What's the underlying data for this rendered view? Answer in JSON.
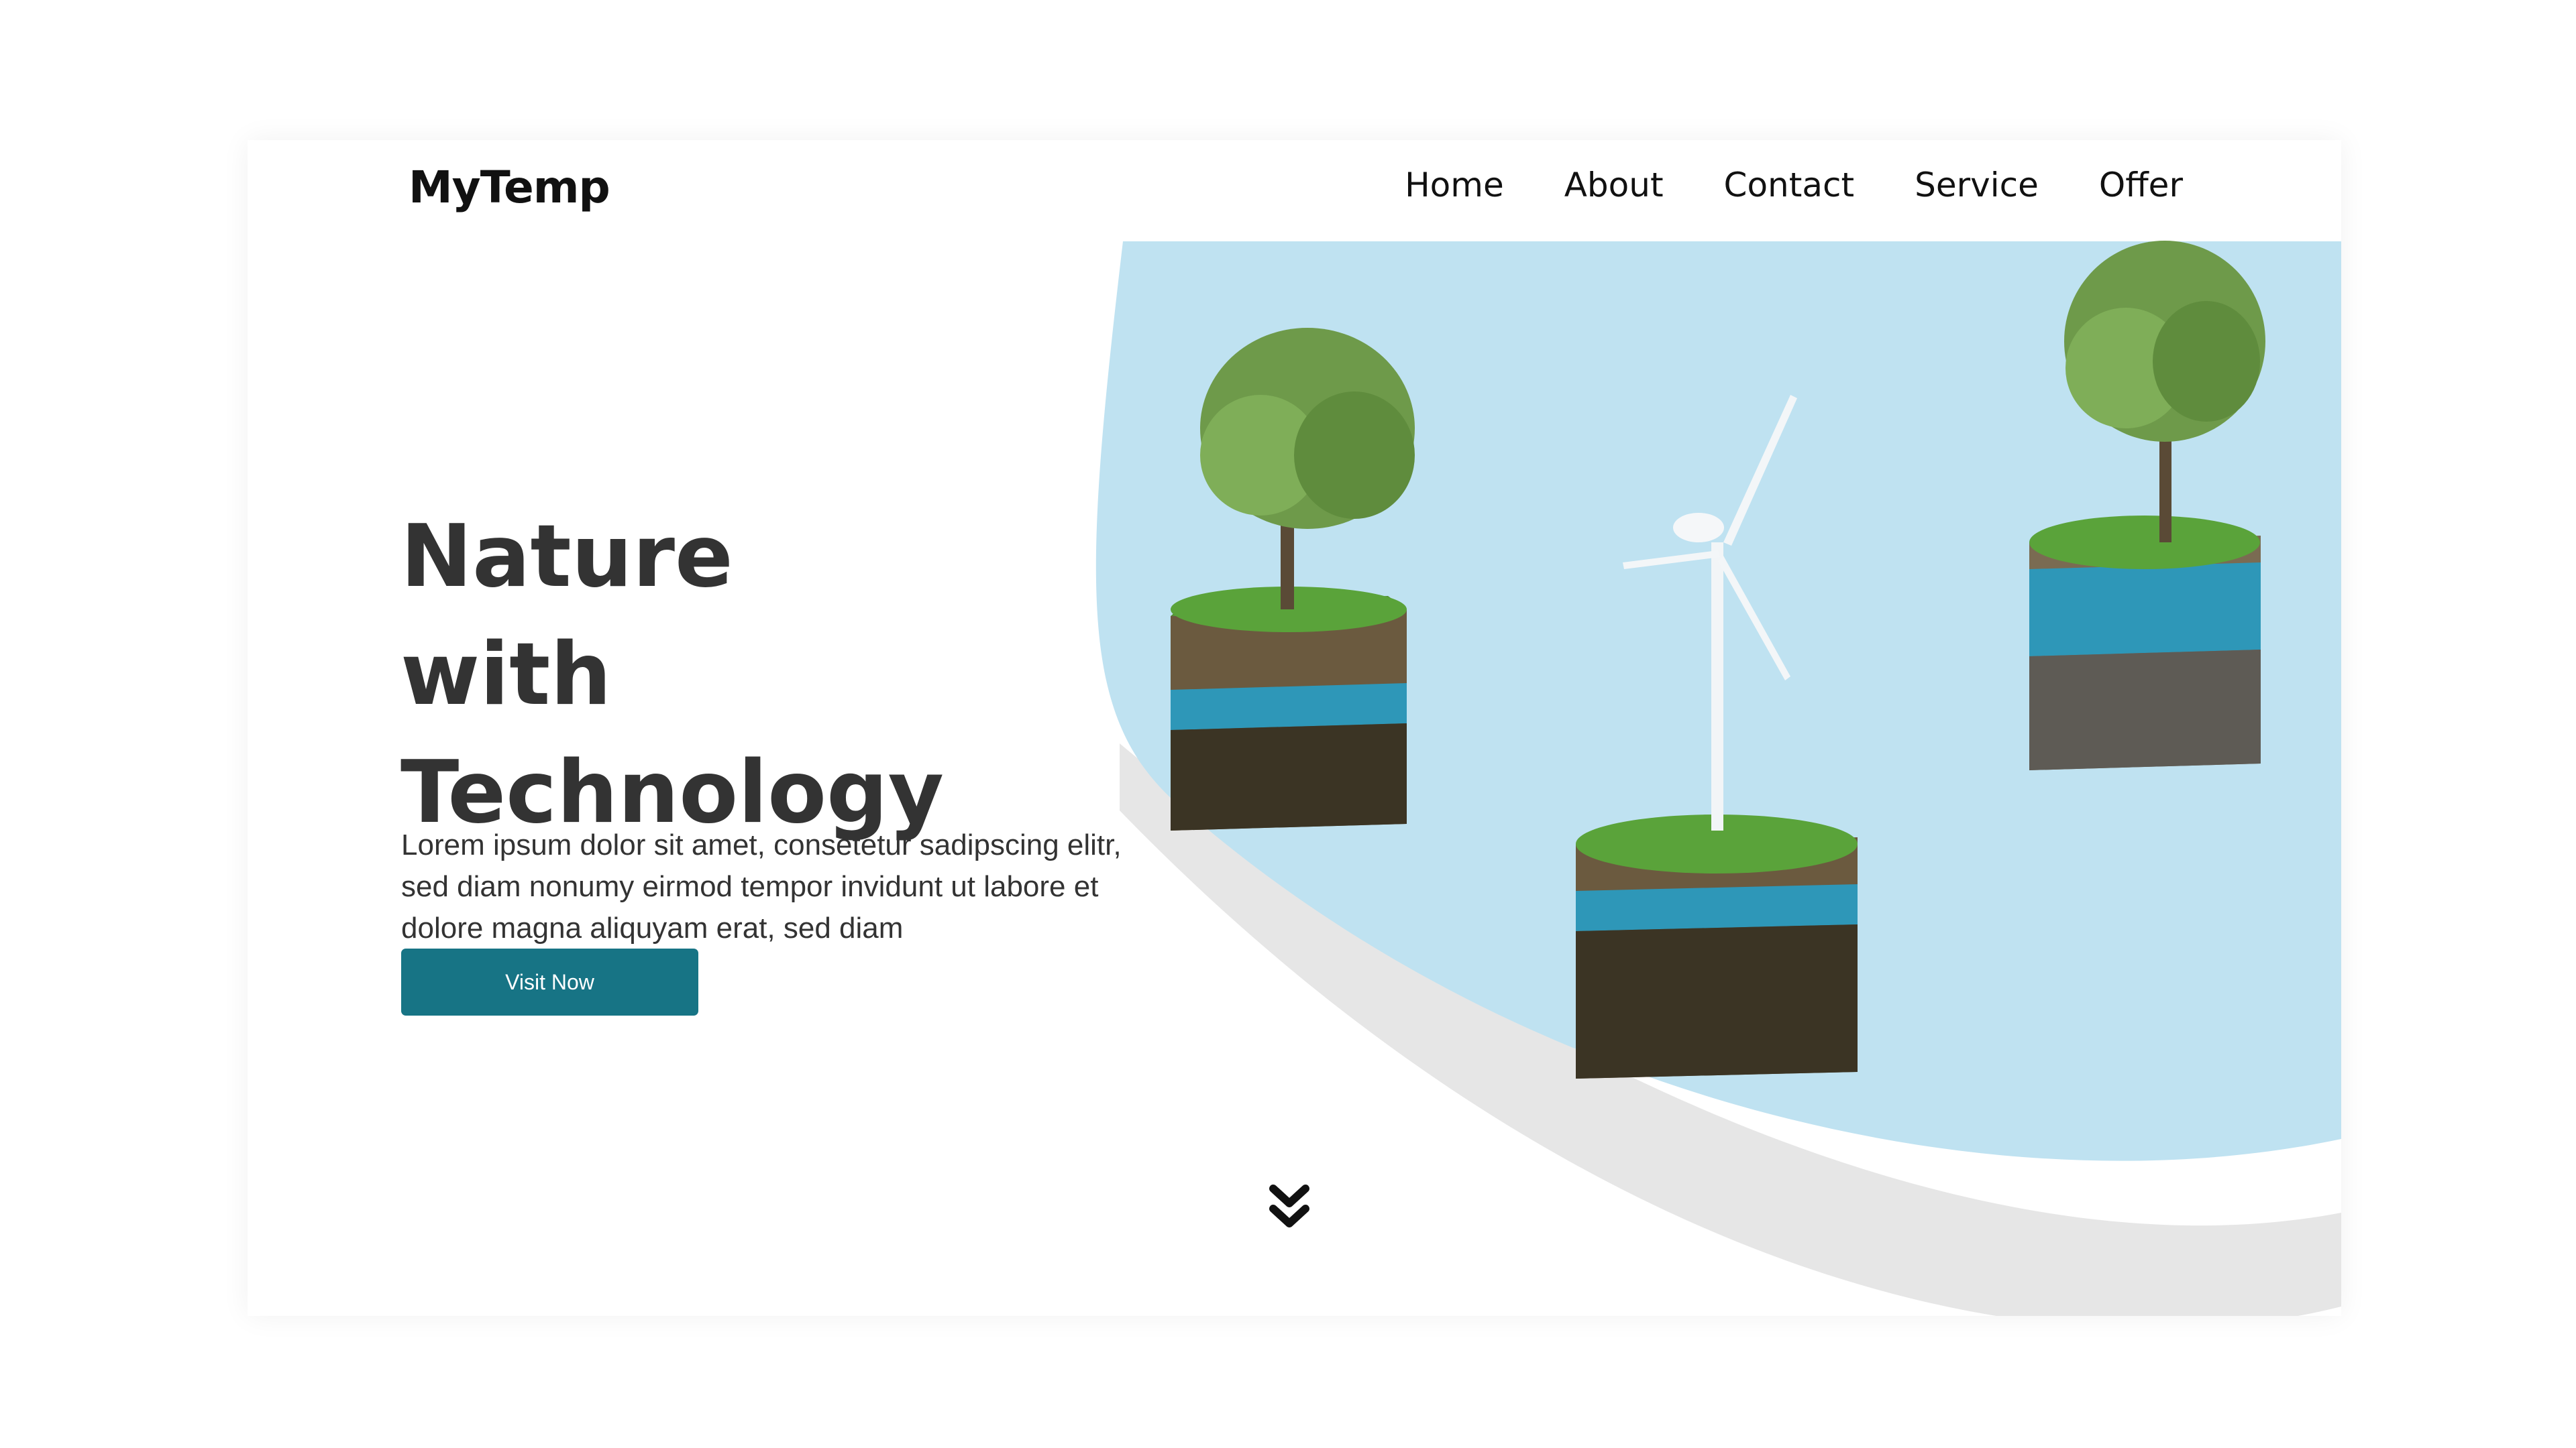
{
  "header": {
    "logo": "MyTemp",
    "nav": [
      "Home",
      "About",
      "Contact",
      "Service",
      "Offer"
    ]
  },
  "hero": {
    "title_lines": [
      "Nature",
      "with",
      "Technology"
    ],
    "description": "Lorem ipsum dolor sit amet, consetetur sadipscing elitr, sed diam nonumy eirmod tempor invidunt ut labore et dolore magna aliquyam erat, sed diam",
    "cta_label": "Visit Now"
  },
  "icons": {
    "scroll": "double-chevron-down-icon"
  },
  "colors": {
    "accent": "#177485",
    "sky": "#bfe2f1",
    "text": "#333333"
  }
}
